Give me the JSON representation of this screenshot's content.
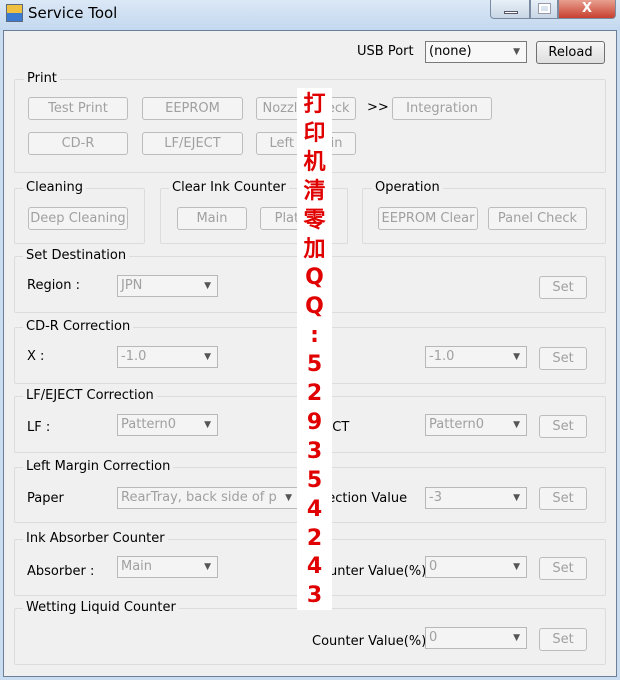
{
  "window": {
    "title": "Service Tool",
    "icon": "app-icon",
    "controls": [
      "minimize",
      "maximize",
      "close"
    ]
  },
  "usb": {
    "label": "USB Port",
    "value": "(none)",
    "reload": "Reload"
  },
  "print": {
    "title": "Print",
    "buttons": [
      "Test Print",
      "EEPROM",
      "Nozzle Check",
      "Integration",
      "CD-R",
      "LF/EJECT",
      "Left Margin"
    ],
    "arrow": ">>"
  },
  "cleaning": {
    "title": "Cleaning",
    "button": "Deep Cleaning"
  },
  "clear_ink": {
    "title": "Clear Ink Counter",
    "main": "Main",
    "platen": "Platen"
  },
  "operation": {
    "title": "Operation",
    "eeprom_clear": "EEPROM Clear",
    "panel_check": "Panel Check"
  },
  "set_destination": {
    "title": "Set Destination",
    "label": "Region :",
    "value": "JPN",
    "set": "Set"
  },
  "cdr": {
    "title": "CD-R Correction",
    "x_label": "X :",
    "x_value": "-1.0",
    "y_value": "-1.0",
    "set": "Set"
  },
  "lf": {
    "title": "LF/EJECT Correction",
    "lf_label": "LF :",
    "lf_value": "Pattern0",
    "eject_label": "EJECT",
    "eject_value": "Pattern0",
    "set": "Set"
  },
  "left_margin": {
    "title": "Left Margin Correction",
    "paper_label": "Paper",
    "paper_value": "RearTray, back side of p",
    "corr_label": "Correction Value",
    "corr_value": "-3",
    "set": "Set"
  },
  "ink_absorber": {
    "title": "Ink Absorber Counter",
    "label": "Absorber :",
    "value": "Main",
    "counter_label": "Counter Value(%)",
    "counter_value": "0",
    "set": "Set"
  },
  "wetting": {
    "title": "Wetting Liquid Counter",
    "counter_label": "Counter Value(%)",
    "counter_value": "0",
    "set": "Set"
  },
  "watermark": {
    "chars": [
      "打",
      "印",
      "机",
      "清",
      "零",
      "加",
      "Q",
      "Q",
      ":",
      "5",
      "2",
      "9",
      "3",
      "5",
      "4",
      "2",
      "4",
      "3"
    ],
    "color": "#e00000"
  }
}
